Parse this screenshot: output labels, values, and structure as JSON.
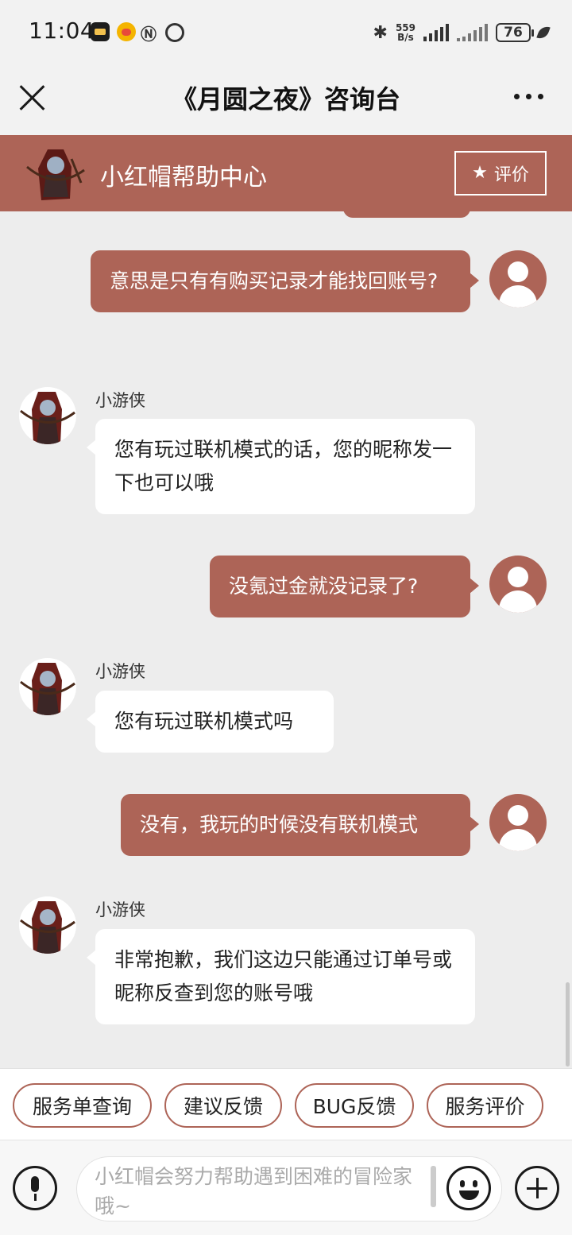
{
  "status_bar": {
    "time": "11:04",
    "net_speed_value": "559",
    "net_speed_unit": "B/s",
    "battery": "76"
  },
  "title_bar": {
    "title": "《月圆之夜》咨询台"
  },
  "help_header": {
    "title": "小红帽帮助中心",
    "rate_label": "评价"
  },
  "chat": {
    "agent_name": "小游侠",
    "messages": [
      {
        "from": "user",
        "text": "意思是只有有购买记录才能找回账号?"
      },
      {
        "from": "agent",
        "text": "您有玩过联机模式的话，您的昵称发一下也可以哦"
      },
      {
        "from": "user",
        "text": "没氪过金就没记录了?"
      },
      {
        "from": "agent",
        "text": "您有玩过联机模式吗"
      },
      {
        "from": "user",
        "text": "没有，我玩的时候没有联机模式"
      },
      {
        "from": "agent",
        "text": "非常抱歉，我们这边只能通过订单号或昵称反查到您的账号哦"
      }
    ]
  },
  "quick_actions": [
    "服务单查询",
    "建议反馈",
    "BUG反馈",
    "服务评价"
  ],
  "input": {
    "placeholder": "小红帽会努力帮助遇到困难的冒险家哦~"
  },
  "colors": {
    "accent": "#ad6457",
    "background": "#ededed"
  }
}
